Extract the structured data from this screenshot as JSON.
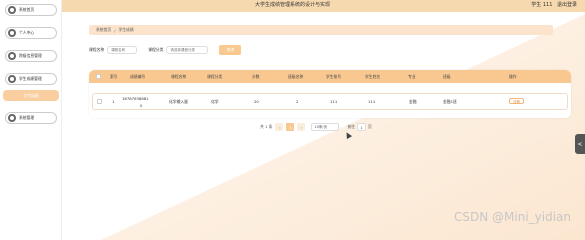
{
  "header": {
    "title": "大学生成绩管理系统的设计与实现",
    "user": "学生 111",
    "logout": "退出登录"
  },
  "sidebar": {
    "items": [
      {
        "label": "系统首页"
      },
      {
        "label": "个人中心"
      },
      {
        "label": "院级信息管理"
      },
      {
        "label": "学生成绩管理"
      },
      {
        "label": "系统管理"
      }
    ],
    "active_sub": "学生成绩"
  },
  "breadcrumb": {
    "home": "系统首页",
    "sep": "/",
    "current": "学生成绩"
  },
  "search": {
    "course_name_label": "课程名称",
    "course_name_placeholder": "课程名称",
    "course_type_label": "课程分类",
    "course_type_placeholder": "请选择课程分类",
    "button": "查询"
  },
  "table": {
    "headers": [
      "索引",
      "成绩编号",
      "课程名称",
      "课程分类",
      "分数",
      "班级名称",
      "学生账号",
      "学生姓名",
      "专业",
      "班级",
      "操作"
    ],
    "rows": [
      {
        "index": "1",
        "no_line1": "16787638681",
        "no_line2": "0",
        "name": "化学输入量",
        "type": "化学",
        "score": "20",
        "class_name": "2",
        "account": "111",
        "student": "111",
        "major": "金融",
        "class": "金融1班",
        "action": "详情"
      }
    ]
  },
  "pager": {
    "total": "共 1 条",
    "prev": "<",
    "page": "1",
    "next": ">",
    "size": "10条/页",
    "goto": "前往",
    "jump": "1",
    "page_unit": "页"
  },
  "side_tab": "<",
  "watermark": "CSDN @Mini_yidian"
}
